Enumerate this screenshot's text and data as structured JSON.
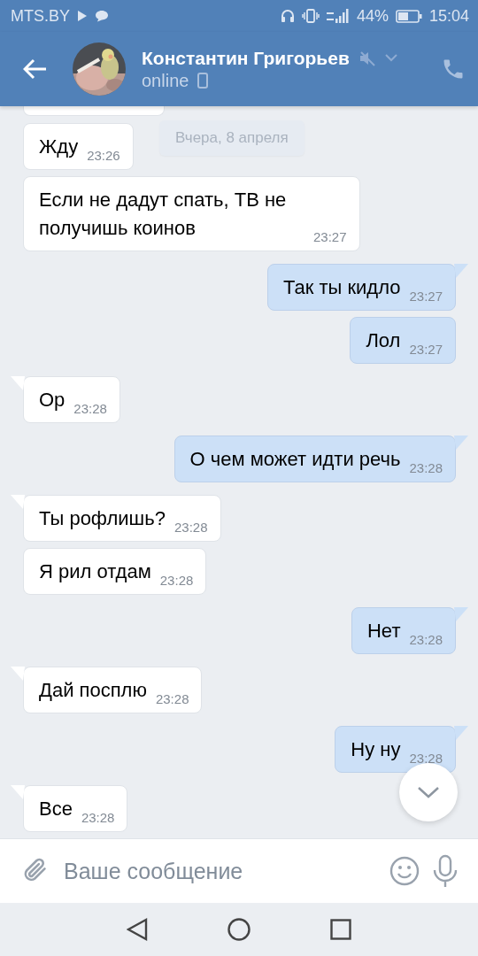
{
  "status_bar": {
    "carrier": "MTS.BY",
    "battery": "44%",
    "time": "15:04"
  },
  "header": {
    "name": "Константин Григорьев",
    "status": "online"
  },
  "date_pill": "Вчера, 8 апреля",
  "messages": [
    {
      "text": "Жду",
      "time": "23:26",
      "outgoing": false,
      "tail": false
    },
    {
      "text": "Если не дадут спать, ТВ не получишь коинов",
      "time": "23:27",
      "outgoing": false,
      "tail": false
    },
    {
      "text": "Так ты кидло",
      "time": "23:27",
      "outgoing": true,
      "tail": true
    },
    {
      "text": "Лол",
      "time": "23:27",
      "outgoing": true,
      "tail": false
    },
    {
      "text": "Ор",
      "time": "23:28",
      "outgoing": false,
      "tail": true
    },
    {
      "text": "О чем может идти речь",
      "time": "23:28",
      "outgoing": true,
      "tail": true
    },
    {
      "text": "Ты рофлишь?",
      "time": "23:28",
      "outgoing": false,
      "tail": true
    },
    {
      "text": "Я рил отдам",
      "time": "23:28",
      "outgoing": false,
      "tail": false
    },
    {
      "text": "Нет",
      "time": "23:28",
      "outgoing": true,
      "tail": true
    },
    {
      "text": "Дай посплю",
      "time": "23:28",
      "outgoing": false,
      "tail": true
    },
    {
      "text": "Ну ну",
      "time": "23:28",
      "outgoing": true,
      "tail": true
    },
    {
      "text": "Все",
      "time": "23:28",
      "outgoing": false,
      "tail": true
    }
  ],
  "composer": {
    "placeholder": "Ваше сообщение"
  }
}
